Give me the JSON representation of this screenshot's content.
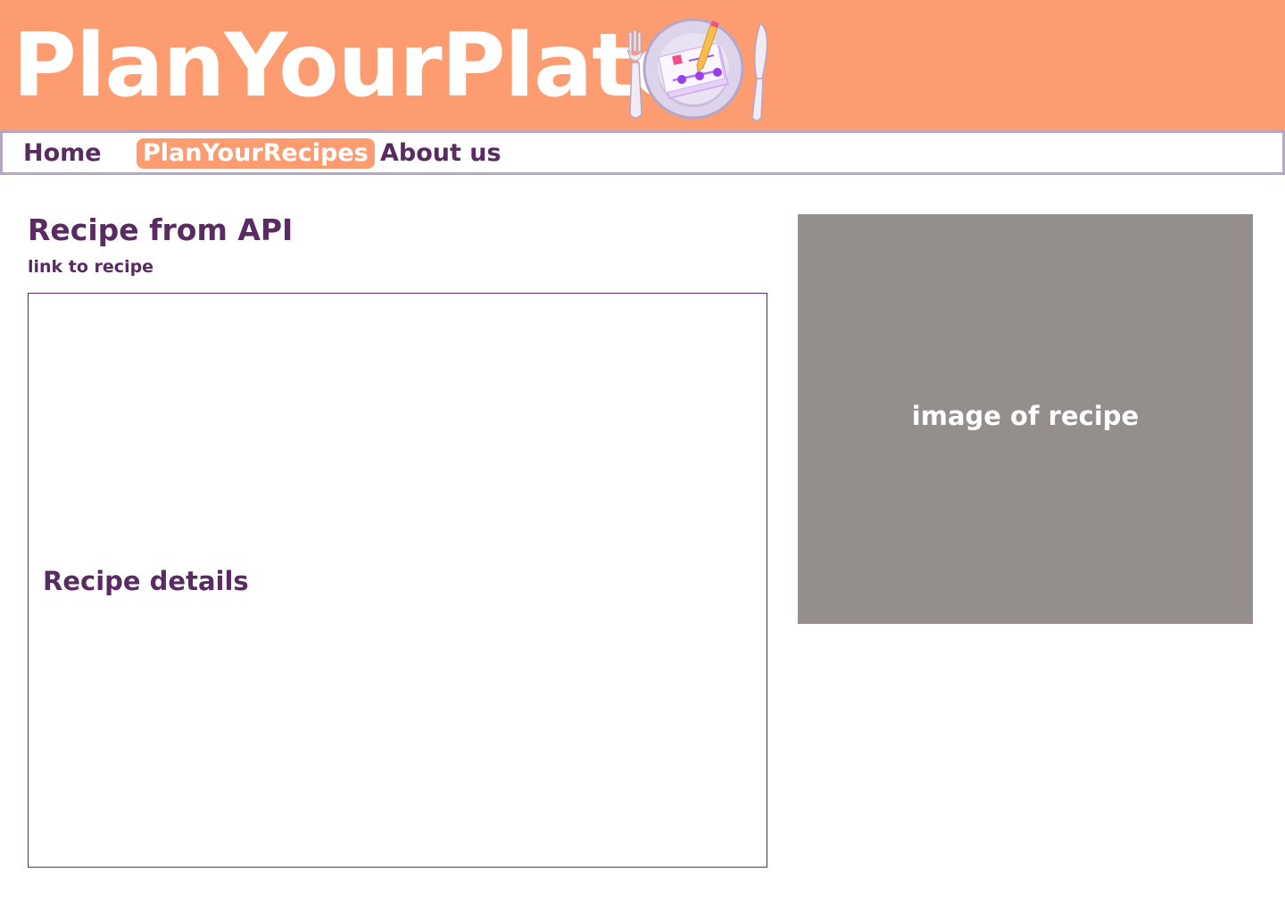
{
  "header": {
    "site_title": "PlanYourPlate",
    "logo_icon": "plate-with-cutlery-and-planner-icon"
  },
  "nav": {
    "items": [
      {
        "label": "Home",
        "active": false
      },
      {
        "label": "PlanYourRecipes",
        "active": true
      },
      {
        "label": "About us",
        "active": false
      }
    ]
  },
  "main": {
    "recipe_title": "Recipe from API",
    "recipe_link": "link to recipe",
    "details_label": "Recipe details",
    "image_label": "image of recipe"
  },
  "colors": {
    "brand_orange": "#fd9c71",
    "text_purple": "#5a2a62",
    "nav_border": "#b6a6c6",
    "image_placeholder": "#948e8d"
  }
}
